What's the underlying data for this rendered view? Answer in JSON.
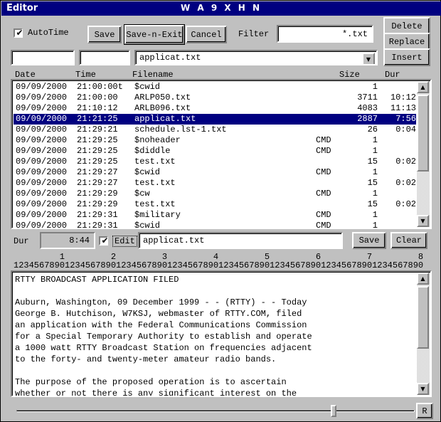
{
  "window": {
    "title": "Editor",
    "callsign": "W A 9 X H N",
    "title_bg": "#000080",
    "face": "#c0c0c0"
  },
  "toolbar": {
    "autotime_label": "AutoTime",
    "autotime_checked": true,
    "save_label": "Save",
    "save_n_exit_label": "Save-n-Exit",
    "cancel_label": "Cancel",
    "filter_label": "Filter",
    "filter_value": "*.txt",
    "delete_label": "Delete",
    "replace_label": "Replace",
    "insert_label": "Insert"
  },
  "entry_row": {
    "date_value": "",
    "time_value": "",
    "filename_value": "applicat.txt",
    "dropdown_icon": "chevron-down-icon"
  },
  "list": {
    "columns": [
      "Date",
      "Time",
      "Filename",
      "Size",
      "Dur"
    ],
    "selected_index": 3,
    "rows": [
      {
        "date": "09/09/2000",
        "time": "21:00:00t",
        "name": "$cwid",
        "cmd": "",
        "size": "1",
        "dur": ""
      },
      {
        "date": "09/09/2000",
        "time": "21:00:00",
        "name": "ARLP050.txt",
        "cmd": "",
        "size": "3711",
        "dur": "10:12"
      },
      {
        "date": "09/09/2000",
        "time": "21:10:12",
        "name": "ARLB096.txt",
        "cmd": "",
        "size": "4083",
        "dur": "11:13"
      },
      {
        "date": "09/09/2000",
        "time": "21:21:25",
        "name": "applicat.txt",
        "cmd": "",
        "size": "2887",
        "dur": "7:56"
      },
      {
        "date": "09/09/2000",
        "time": "21:29:21",
        "name": "schedule.lst-1.txt",
        "cmd": "",
        "size": "26",
        "dur": "0:04"
      },
      {
        "date": "09/09/2000",
        "time": "21:29:25",
        "name": "$noheader",
        "cmd": "CMD",
        "size": "1",
        "dur": ""
      },
      {
        "date": "09/09/2000",
        "time": "21:29:25",
        "name": "$diddle",
        "cmd": "CMD",
        "size": "1",
        "dur": ""
      },
      {
        "date": "09/09/2000",
        "time": "21:29:25",
        "name": "test.txt",
        "cmd": "",
        "size": "15",
        "dur": "0:02"
      },
      {
        "date": "09/09/2000",
        "time": "21:29:27",
        "name": "$cwid",
        "cmd": "CMD",
        "size": "1",
        "dur": ""
      },
      {
        "date": "09/09/2000",
        "time": "21:29:27",
        "name": "test.txt",
        "cmd": "",
        "size": "15",
        "dur": "0:02"
      },
      {
        "date": "09/09/2000",
        "time": "21:29:29",
        "name": "$cw",
        "cmd": "CMD",
        "size": "1",
        "dur": ""
      },
      {
        "date": "09/09/2000",
        "time": "21:29:29",
        "name": "test.txt",
        "cmd": "",
        "size": "15",
        "dur": "0:02"
      },
      {
        "date": "09/09/2000",
        "time": "21:29:31",
        "name": "$military",
        "cmd": "CMD",
        "size": "1",
        "dur": ""
      },
      {
        "date": "09/09/2000",
        "time": "21:29:31",
        "name": "$cwid",
        "cmd": "CMD",
        "size": "1",
        "dur": ""
      }
    ],
    "scroll_up_icon": "triangle-up-icon",
    "scroll_down_icon": "triangle-down-icon"
  },
  "edit_bar": {
    "dur_label": "Dur",
    "dur_value": "8:44",
    "edit_label": "Edit",
    "edit_checked": true,
    "filename_value": "applicat.txt",
    "save_label": "Save",
    "clear_label": "Clear"
  },
  "ruler": {
    "tens": "         1         2         3         4         5         6         7         8",
    "digits": "12345678901234567890123456789012345678901234567890123456789012345678901234567890"
  },
  "editor": {
    "text": "RTTY BROADCAST APPLICATION FILED\n\nAuburn, Washington, 09 December 1999 - - (RTTY) - - Today\nGeorge B. Hutchison, W7KSJ, webmaster of RTTY.COM, filed\nan application with the Federal Communications Commission\nfor a Special Temporary Authority to establish and operate\na 1000 watt RTTY Broadcast Station on frequencies adjacent\nto the forty- and twenty-meter amateur radio bands.\n\nThe purpose of the proposed operation is to ascertain\nwhether or not there is any significant interest on the",
    "scroll_up_icon": "triangle-up-icon",
    "scroll_down_icon": "triangle-down-icon"
  },
  "bottom": {
    "scale_position_percent": 80,
    "r_button_label": "R"
  }
}
